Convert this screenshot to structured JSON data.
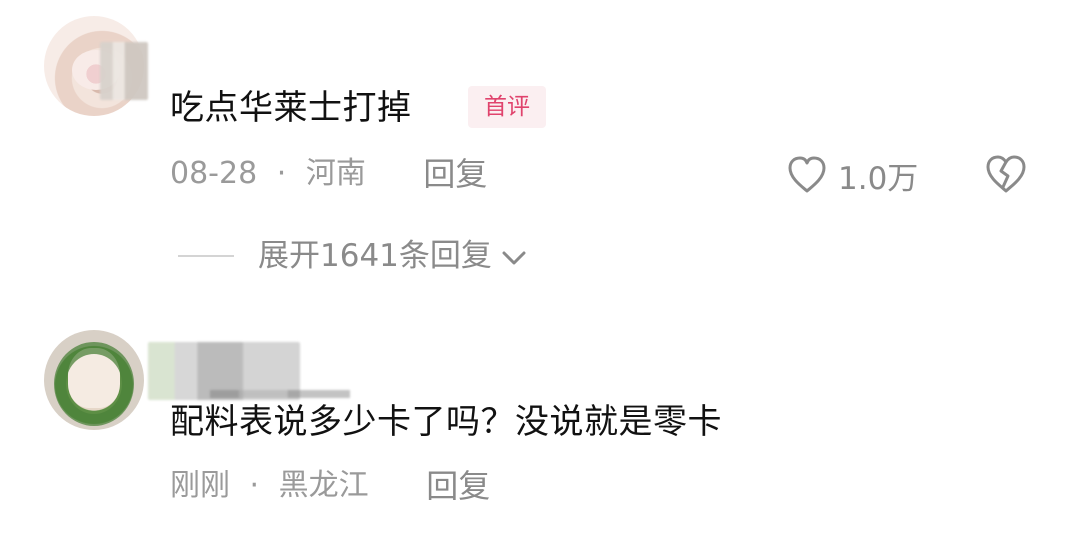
{
  "comments": [
    {
      "text": "吃点华莱士打掉",
      "badge": "首评",
      "date": "08-28",
      "separator": "·",
      "region": "河南",
      "reply_label": "回复",
      "likes": "1.0万",
      "expand_label": "展开1641条回复",
      "icons": {
        "like": "heart-icon",
        "dislike": "broken-heart-icon",
        "expand": "chevron-down-icon"
      }
    },
    {
      "text": "配料表说多少卡了吗？没说就是零卡",
      "date": "刚刚",
      "separator": "·",
      "region": "黑龙江",
      "reply_label": "回复"
    }
  ],
  "colors": {
    "primary_text": "#111111",
    "secondary_text": "#9a9a9a",
    "badge_text": "#e0436d",
    "badge_bg": "#fbeff1"
  }
}
